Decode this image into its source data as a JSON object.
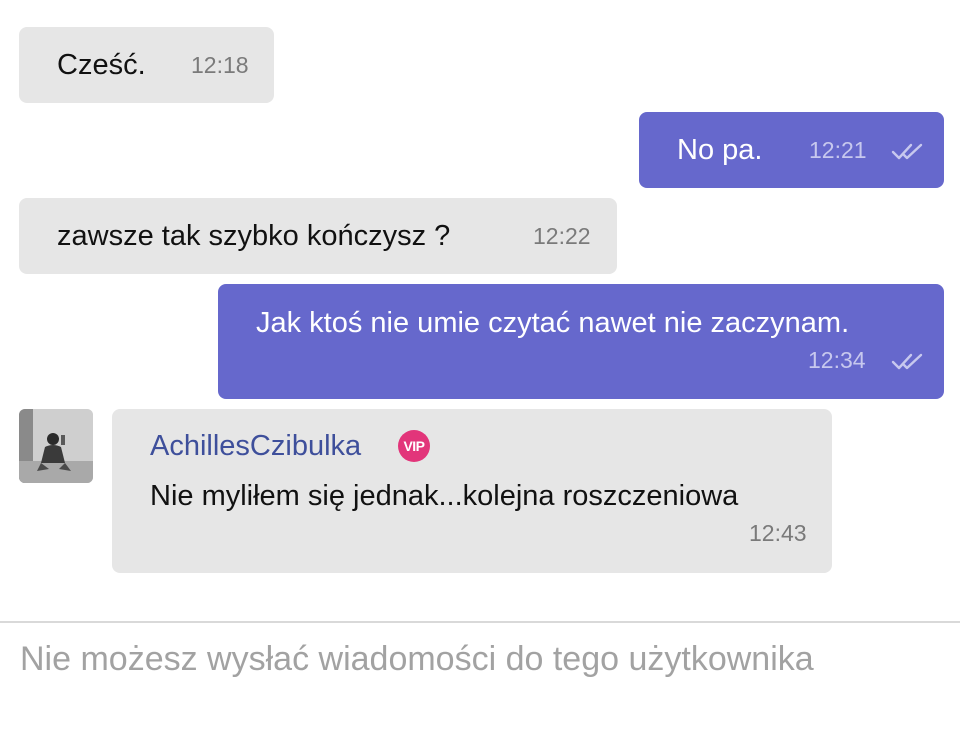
{
  "messages": [
    {
      "direction": "in",
      "text": "Cześć.",
      "time": "12:18"
    },
    {
      "direction": "out",
      "text": "No pa.",
      "time": "12:21",
      "status_icon": "double-check-icon"
    },
    {
      "direction": "in",
      "text": "zawsze tak szybko kończysz ?",
      "time": "12:22"
    },
    {
      "direction": "out",
      "text": "Jak ktoś nie umie czytać nawet nie zaczynam.",
      "time": "12:34",
      "status_icon": "double-check-icon"
    },
    {
      "direction": "in",
      "sender": "AchillesCzibulka",
      "badge": "VIP",
      "text": "Nie myliłem się jednak...kolejna roszczeniowa",
      "time": "12:43"
    }
  ],
  "composer": {
    "notice": "Nie możesz wysłać wiadomości do tego użytkownika"
  },
  "colors": {
    "incoming_bubble": "#e6e6e6",
    "outgoing_bubble": "#6668cc",
    "sender_name": "#3e4f9b",
    "vip_badge": "#e2357a"
  }
}
